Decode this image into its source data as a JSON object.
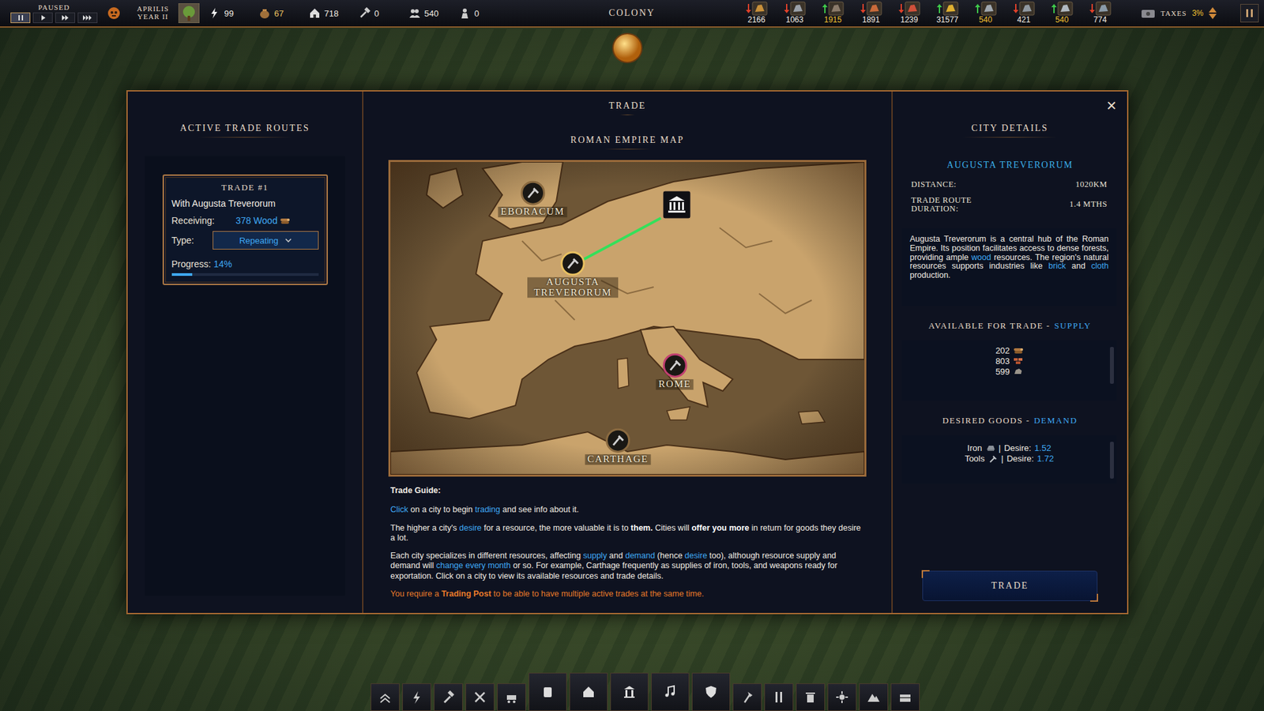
{
  "top_bar": {
    "paused_label": "PAUSED",
    "speed_buttons": [
      {
        "kind": "pause",
        "selected": true
      },
      {
        "kind": "play",
        "selected": false
      },
      {
        "kind": "fast",
        "selected": false
      },
      {
        "kind": "fastest",
        "selected": false
      }
    ],
    "date": {
      "month": "APRILIS",
      "year": "YEAR II"
    },
    "stats": [
      {
        "kind": "energy",
        "value": "99",
        "highlighted": false
      },
      {
        "kind": "food",
        "value": "67",
        "highlighted": true
      },
      {
        "kind": "housing",
        "value": "718",
        "highlighted": false
      },
      {
        "kind": "workers",
        "value": "0",
        "highlighted": false
      },
      {
        "kind": "population",
        "value": "540",
        "highlighted": false
      },
      {
        "kind": "soldiers",
        "value": "0",
        "highlighted": false
      }
    ],
    "mode": "COLONY",
    "resources": [
      {
        "value": "2166",
        "trend": "down",
        "highlighted": false
      },
      {
        "value": "1063",
        "trend": "down",
        "highlighted": false
      },
      {
        "value": "1915",
        "trend": "up",
        "highlighted": true
      },
      {
        "value": "1891",
        "trend": "down",
        "highlighted": false
      },
      {
        "value": "1239",
        "trend": "down",
        "highlighted": false
      },
      {
        "value": "31577",
        "trend": "up",
        "highlighted": false
      },
      {
        "value": "540",
        "trend": "up",
        "highlighted": true
      },
      {
        "value": "421",
        "trend": "down",
        "highlighted": false
      },
      {
        "value": "540",
        "trend": "up",
        "highlighted": true
      },
      {
        "value": "774",
        "trend": "down",
        "highlighted": false
      }
    ],
    "taxes": {
      "label": "TAXES",
      "value": "3%"
    }
  },
  "dialog": {
    "title": "TRADE",
    "close": "×"
  },
  "active_routes": {
    "title": "ACTIVE TRADE ROUTES",
    "routes": [
      {
        "title": "TRADE #1",
        "partner": "With Augusta Treverorum",
        "receiving_label": "Receiving:",
        "receiving": "378 Wood",
        "type_label": "Type:",
        "type": "Repeating",
        "progress_label": "Progress:",
        "progress": "14%",
        "level": 0.14
      }
    ]
  },
  "map": {
    "title": "ROMAN EMPIRE MAP",
    "cities": [
      {
        "name": "EBORACUM",
        "selected": false
      },
      {
        "name": "AUGUSTA TREVERORUM",
        "selected": true
      },
      {
        "name": "ROME",
        "selected": false
      },
      {
        "name": "CARTHAGE",
        "selected": false
      }
    ]
  },
  "guide": {
    "title": "Trade Guide:",
    "paragraphs": [
      [
        {
          "text": "Click",
          "style": "accent"
        },
        {
          "text": " on a city to begin ",
          "style": "plain"
        },
        {
          "text": "trading",
          "style": "accent"
        },
        {
          "text": " and see info about it.",
          "style": "plain"
        }
      ],
      [
        {
          "text": "The higher a city's ",
          "style": "plain"
        },
        {
          "text": "desire",
          "style": "accent"
        },
        {
          "text": " for a resource, the more valuable it is to ",
          "style": "plain"
        },
        {
          "text": "them.",
          "style": "bold"
        },
        {
          "text": " Cities will ",
          "style": "plain"
        },
        {
          "text": "offer you more",
          "style": "bold"
        },
        {
          "text": " in return for goods they desire a lot.",
          "style": "plain"
        }
      ],
      [
        {
          "text": "Each city specializes in different resources, affecting ",
          "style": "plain"
        },
        {
          "text": "supply",
          "style": "accent"
        },
        {
          "text": " and ",
          "style": "plain"
        },
        {
          "text": "demand",
          "style": "accent"
        },
        {
          "text": " (hence ",
          "style": "plain"
        },
        {
          "text": "desire",
          "style": "accent"
        },
        {
          "text": " too), although resource supply and demand will ",
          "style": "plain"
        },
        {
          "text": "change every month",
          "style": "accent"
        },
        {
          "text": " or so. For example, Carthage frequently as supplies of iron, tools, and weapons ready for exportation. Click on a city to view its available resources and trade details.",
          "style": "plain"
        }
      ]
    ],
    "warning": [
      {
        "text": "You require a ",
        "style": "plain"
      },
      {
        "text": "Trading Post",
        "style": "bold"
      },
      {
        "text": " to be able to have multiple active trades at the same time.",
        "style": "plain"
      }
    ]
  },
  "city": {
    "title": "CITY DETAILS",
    "name": "AUGUSTA TREVERORUM",
    "facts": [
      {
        "label": "DISTANCE:",
        "value": "1020KM"
      },
      {
        "label": "TRADE ROUTE DURATION:",
        "value": "1.4 MTHS"
      }
    ],
    "description": [
      {
        "text": "Augusta Treverorum is a central hub of the Roman Empire. Its position facilitates access to dense forests, providing ample ",
        "style": "plain"
      },
      {
        "text": "wood",
        "style": "accent"
      },
      {
        "text": " resources. The region's natural resources supports industries like ",
        "style": "plain"
      },
      {
        "text": "brick",
        "style": "accent"
      },
      {
        "text": " and ",
        "style": "plain"
      },
      {
        "text": "cloth",
        "style": "accent"
      },
      {
        "text": " production.",
        "style": "plain"
      }
    ],
    "supply": {
      "title": "AVAILABLE FOR TRADE -",
      "accent": "SUPPLY",
      "items": [
        {
          "amount": "202",
          "kind": "wood"
        },
        {
          "amount": "803",
          "kind": "brick"
        },
        {
          "amount": "599",
          "kind": "stone"
        }
      ]
    },
    "demand": {
      "title": "DESIRED GOODS -",
      "accent": "DEMAND",
      "items": [
        {
          "name": "Iron",
          "kind": "iron",
          "separator": "|",
          "desire_label": "Desire:",
          "desire": "1.52"
        },
        {
          "name": "Tools",
          "kind": "tools",
          "separator": "|",
          "desire_label": "Desire:",
          "desire": "1.72"
        }
      ]
    },
    "button": "TRADE"
  }
}
